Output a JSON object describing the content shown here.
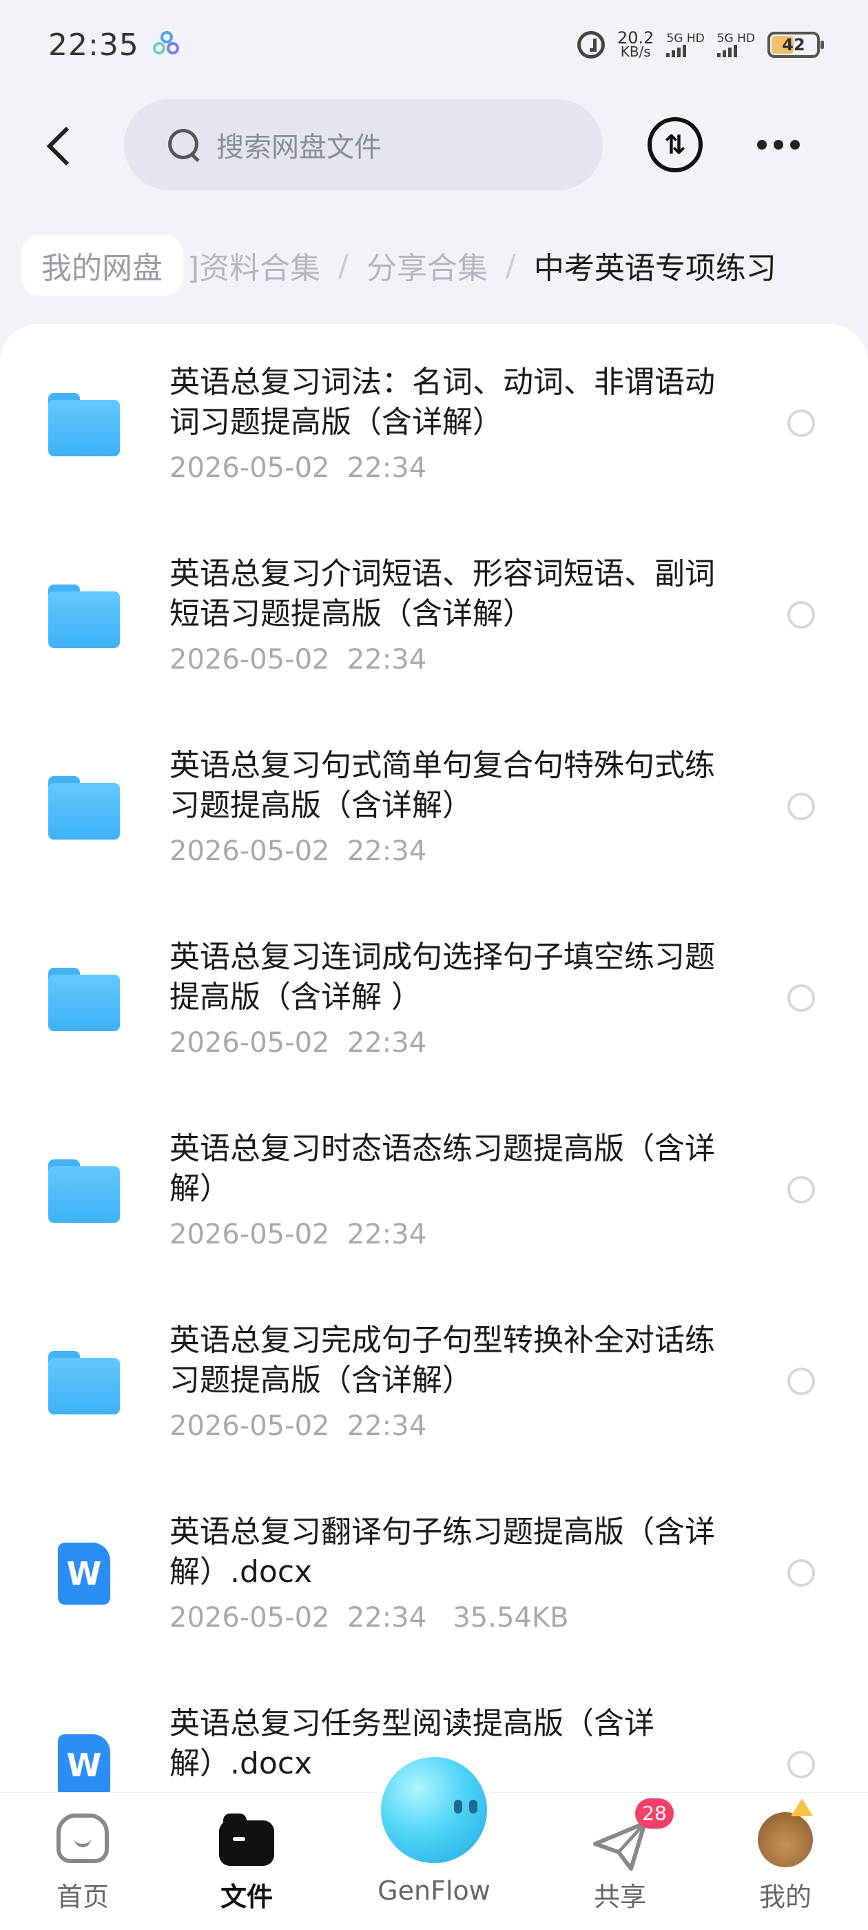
{
  "status_bar": {
    "time": "22:35",
    "net_speed_value": "20.2",
    "net_speed_unit": "KB/s",
    "sim1": "5G HD",
    "sim2": "5G HD",
    "battery": "42"
  },
  "header": {
    "search_placeholder": "搜索网盘文件",
    "transfer_icon_glyph": "⇅"
  },
  "breadcrumb": {
    "home": "我的网盘",
    "items": [
      "]资料合集",
      "分享合集"
    ],
    "separator": "/",
    "current": "中考英语专项练习"
  },
  "files": [
    {
      "title": "英语总复习词法：名词、动词、非谓语动词习题提高版（含详解）",
      "date": "2026-05-02  22:34",
      "size": "",
      "type": "folder"
    },
    {
      "title": "英语总复习介词短语、形容词短语、副词短语习题提高版（含详解）",
      "date": "2026-05-02  22:34",
      "size": "",
      "type": "folder"
    },
    {
      "title": "英语总复习句式简单句复合句特殊句式练习题提高版（含详解）",
      "date": "2026-05-02  22:34",
      "size": "",
      "type": "folder"
    },
    {
      "title": "英语总复习连词成句选择句子填空练习题提高版（含详解 ）",
      "date": "2026-05-02  22:34",
      "size": "",
      "type": "folder"
    },
    {
      "title": "英语总复习时态语态练习题提高版（含详解）",
      "date": "2026-05-02  22:34",
      "size": "",
      "type": "folder"
    },
    {
      "title": "英语总复习完成句子句型转换补全对话练习题提高版（含详解）",
      "date": "2026-05-02  22:34",
      "size": "",
      "type": "folder"
    },
    {
      "title": "英语总复习翻译句子练习题提高版（含详解）.docx",
      "date": "2026-05-02  22:34",
      "size": "35.54KB",
      "type": "docx"
    },
    {
      "title": "英语总复习任务型阅读提高版（含详解）.docx",
      "date": "",
      "size": "",
      "type": "docx"
    }
  ],
  "doc_icon_letter": "W",
  "tabbar": {
    "home": "首页",
    "files": "文件",
    "genflow": "GenFlow",
    "share": "共享",
    "share_badge": "28",
    "me": "我的"
  },
  "colors": {
    "accent_folder": "#43b1f5",
    "doc_blue": "#2b8ef5",
    "badge_red": "#f2406a"
  }
}
